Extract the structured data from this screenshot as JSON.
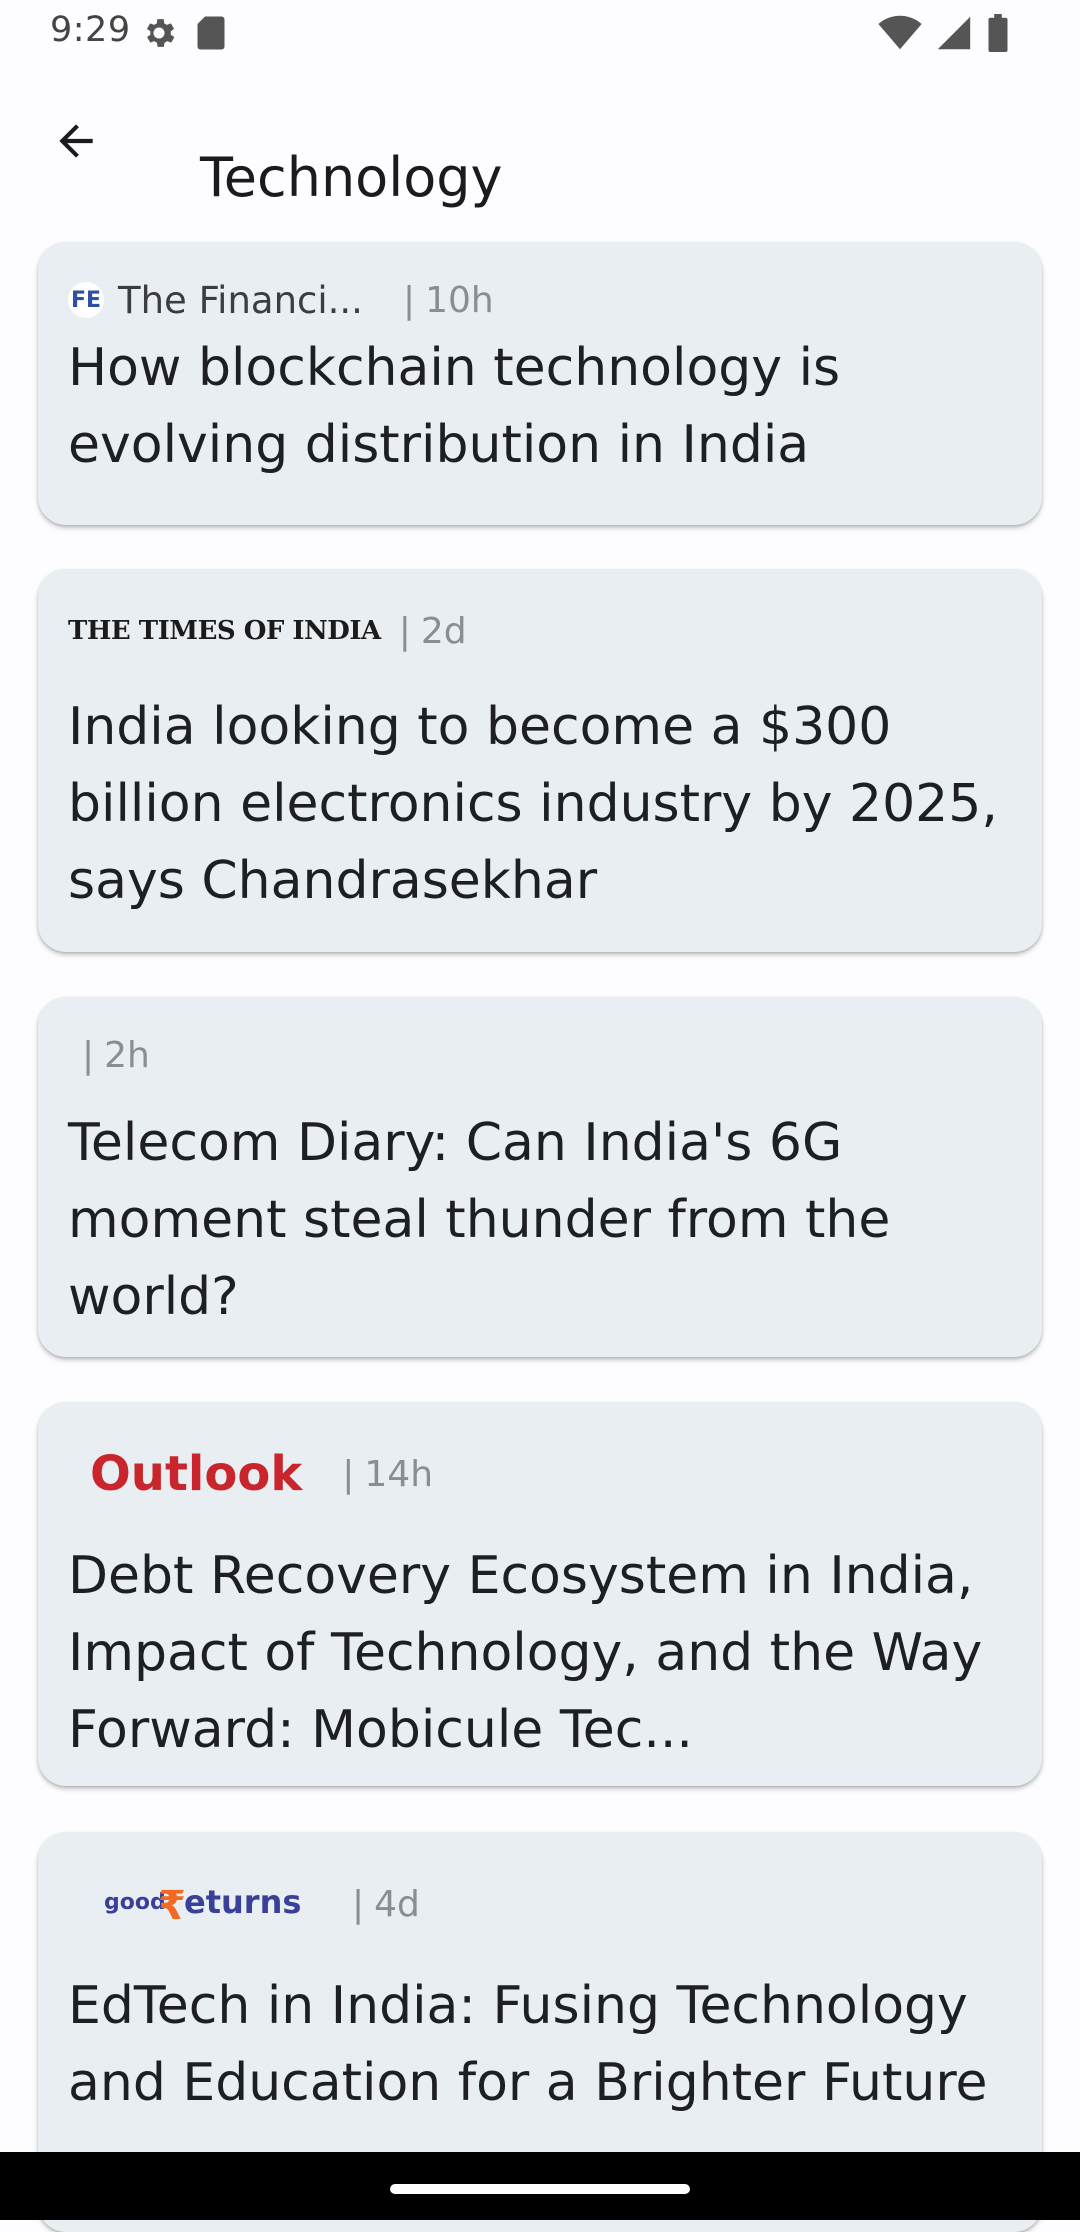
{
  "status_bar": {
    "time": "9:29",
    "icons_left": [
      "settings-icon",
      "sd-card-icon"
    ],
    "icons_right": [
      "wifi-icon",
      "cell-signal-icon",
      "battery-icon"
    ]
  },
  "app_bar": {
    "title": "Technology",
    "back_icon": "arrow-back-icon"
  },
  "articles": [
    {
      "source": "The Financi...",
      "logo": "FE",
      "time": "10h",
      "headline": "How blockchain technology is evolving distribution in India"
    },
    {
      "source": "",
      "logo": "THE TIMES OF INDIA",
      "time": "2d",
      "headline": "India looking to become a $300 billion electronics industry by 2025, says Chandrasekhar"
    },
    {
      "source": "",
      "logo": "",
      "time": "2h",
      "headline": "Telecom Diary: Can India's 6G moment steal thunder from the world?"
    },
    {
      "source": "",
      "logo": "Outlook",
      "time": "14h",
      "headline": "Debt Recovery Ecosystem in India, Impact of Technology, and the Way Forward: Mobicule Tec..."
    },
    {
      "source": "",
      "logo": "goodreturns",
      "time": "4d",
      "headline": "EdTech in India: Fusing Technology and Education for a Brighter Future"
    }
  ],
  "separator": "|",
  "colors": {
    "card_background": "#e9eef3",
    "outlook_red": "#c9252c",
    "goodreturns_blue": "#3a3f9a",
    "goodreturns_orange": "#f26a21"
  }
}
